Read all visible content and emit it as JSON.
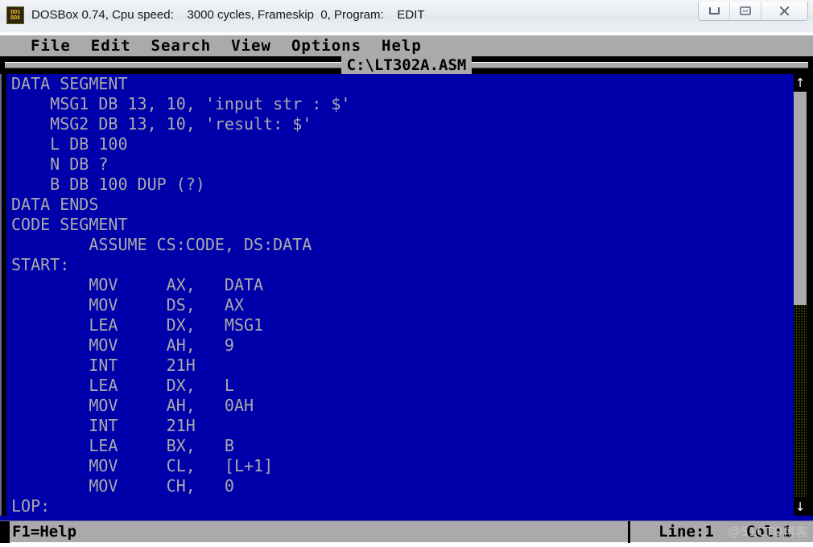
{
  "window": {
    "title": "DOSBox 0.74, Cpu speed:    3000 cycles, Frameskip  0, Program:    EDIT",
    "icon_line1": "DOS",
    "icon_line2": "BOX",
    "controls": {
      "minimize": "minimize-icon",
      "maximize": "maximize-icon",
      "close": "✕"
    },
    "colors": {
      "dos_blue": "#0000AA",
      "dos_gray": "#AAAAAA",
      "dos_black": "#000000",
      "titlebar": "#EEF1F5"
    }
  },
  "menubar": {
    "items": [
      {
        "label": "File"
      },
      {
        "label": "Edit"
      },
      {
        "label": "Search"
      },
      {
        "label": "View"
      },
      {
        "label": "Options"
      },
      {
        "label": "Help"
      }
    ]
  },
  "editor": {
    "filename": "C:\\LT302A.ASM",
    "lines": [
      "DATA SEGMENT",
      "    MSG1 DB 13, 10, 'input str : $'",
      "    MSG2 DB 13, 10, 'result: $'",
      "    L DB 100",
      "    N DB ?",
      "    B DB 100 DUP (?)",
      "DATA ENDS",
      "CODE SEGMENT",
      "        ASSUME CS:CODE, DS:DATA",
      "START:",
      "        MOV     AX,   DATA",
      "        MOV     DS,   AX",
      "        LEA     DX,   MSG1",
      "        MOV     AH,   9",
      "        INT     21H",
      "        LEA     DX,   L",
      "        MOV     AH,   0AH",
      "        INT     21H",
      "        LEA     BX,   B",
      "        MOV     CL,   [L+1]",
      "        MOV     CH,   0",
      "LOP:"
    ]
  },
  "scrollbar": {
    "up_arrow": "↑",
    "down_arrow": "↓"
  },
  "statusbar": {
    "help": "F1=Help",
    "line": "Line:1",
    "col": "Col:1"
  },
  "watermark": "@51CTO博客"
}
